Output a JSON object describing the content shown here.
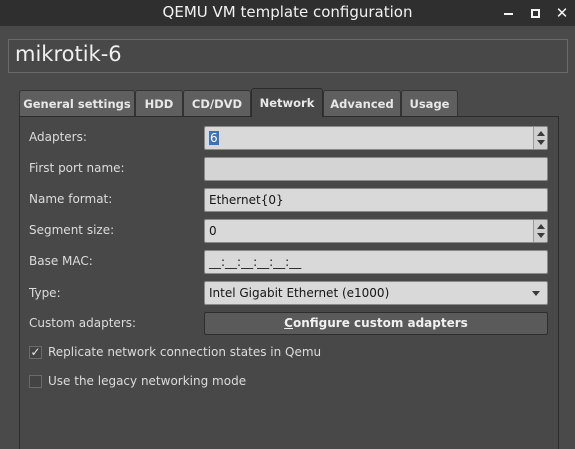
{
  "window": {
    "title": "QEMU VM template configuration"
  },
  "vm": {
    "name": "mikrotik-6"
  },
  "tabs": [
    {
      "label": "General settings",
      "active": false
    },
    {
      "label": "HDD",
      "active": false
    },
    {
      "label": "CD/DVD",
      "active": false
    },
    {
      "label": "Network",
      "active": true
    },
    {
      "label": "Advanced",
      "active": false
    },
    {
      "label": "Usage",
      "active": false
    }
  ],
  "network": {
    "adapters_label": "Adapters:",
    "adapters_value": "6",
    "first_port_label": "First port name:",
    "first_port_value": "",
    "name_format_label": "Name format:",
    "name_format_value": "Ethernet{0}",
    "segment_size_label": "Segment size:",
    "segment_size_value": "0",
    "base_mac_label": "Base MAC:",
    "base_mac_value": "__:__:__:__:__:__",
    "type_label": "Type:",
    "type_value": "Intel Gigabit Ethernet (e1000)",
    "custom_adapters_label": "Custom adapters:",
    "configure_button_first": "C",
    "configure_button_rest": "onfigure custom adapters",
    "replicate_label": "Replicate network connection states in Qemu",
    "replicate_checked": true,
    "legacy_label": "Use the legacy networking mode",
    "legacy_checked": false,
    "check_glyph": "✓"
  },
  "icons": {
    "minimize": "minimize-icon",
    "maximize": "maximize-icon",
    "close": "close-icon",
    "close_glyph": "✕"
  }
}
